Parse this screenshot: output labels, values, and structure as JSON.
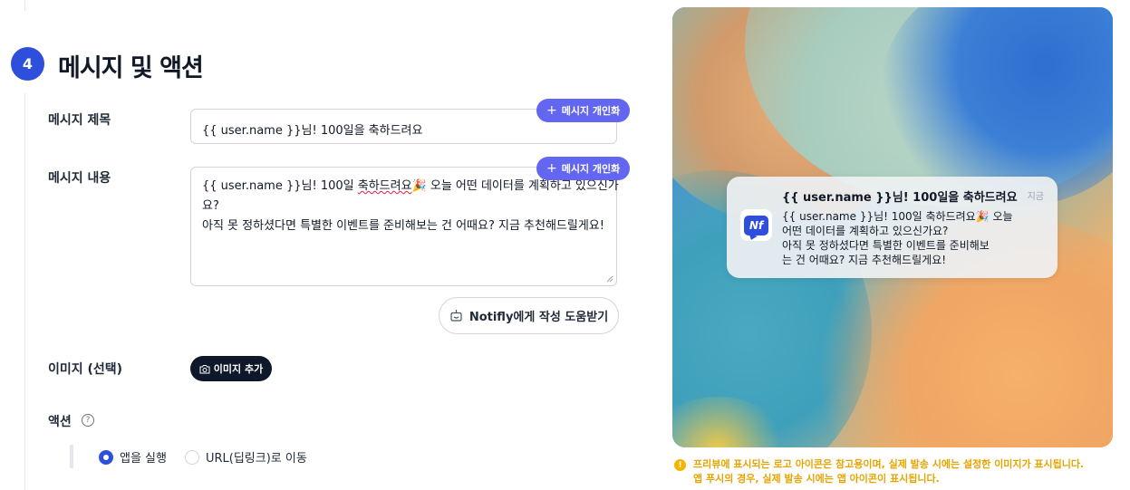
{
  "section": {
    "step_number": "4",
    "title": "메시지 및 액션"
  },
  "message_title": {
    "label": "메시지 제목",
    "value": "{{ user.name }}님! 100일을 축하드려요",
    "personalize_label": "메시지 개인화"
  },
  "message_body": {
    "label": "메시지 내용",
    "line1_a": "{{ user.name }}님! 100일 ",
    "line1_misspelled": "축하드려요",
    "line1_emoji": "🎉",
    "line1_b": " 오늘 어떤 데이터를 계획하고 있으신가",
    "line2": "요?",
    "line3": "아직 못 정하셨다면 특별한 이벤트를 준비해보는 건 어때요? 지금 추천해드릴게요!",
    "personalize_label": "메시지 개인화"
  },
  "writing_help": {
    "label": "Notifly에게 작성 도움받기"
  },
  "image": {
    "label": "이미지 (선택)",
    "add_label": "이미지 추가"
  },
  "action": {
    "label": "액션",
    "help": "?",
    "options": [
      {
        "label": "앱을 실행",
        "checked": true
      },
      {
        "label": "URL(딥링크)로 이동",
        "checked": false
      }
    ]
  },
  "preview": {
    "app_icon_text": "Nf",
    "title": "{{ user.name }}님! 100일을 축하드려요",
    "time": "지금",
    "body_lines": [
      "{{ user.name }}님! 100일 축하드려요🎉 오늘",
      "어떤 데이터를 계획하고 있으신가요?",
      "아직 못 정하셨다면 특별한 이벤트를 준비해보",
      "는 건 어때요? 지금 추천해드릴게요!"
    ]
  },
  "disclaimer": {
    "icon": "!",
    "line1": "프리뷰에 표시되는 로고 아이콘은 참고용이며, 실제 발송 시에는 설정한 이미지가 표시됩니다.",
    "line2": "앱 푸시의 경우, 실제 발송 시에는 앱 아이콘이 표시됩니다."
  },
  "colors": {
    "primary": "#2d4fdb",
    "personalize": "#6366f1",
    "dark_button": "#0f172a",
    "warning": "#e6a400"
  }
}
